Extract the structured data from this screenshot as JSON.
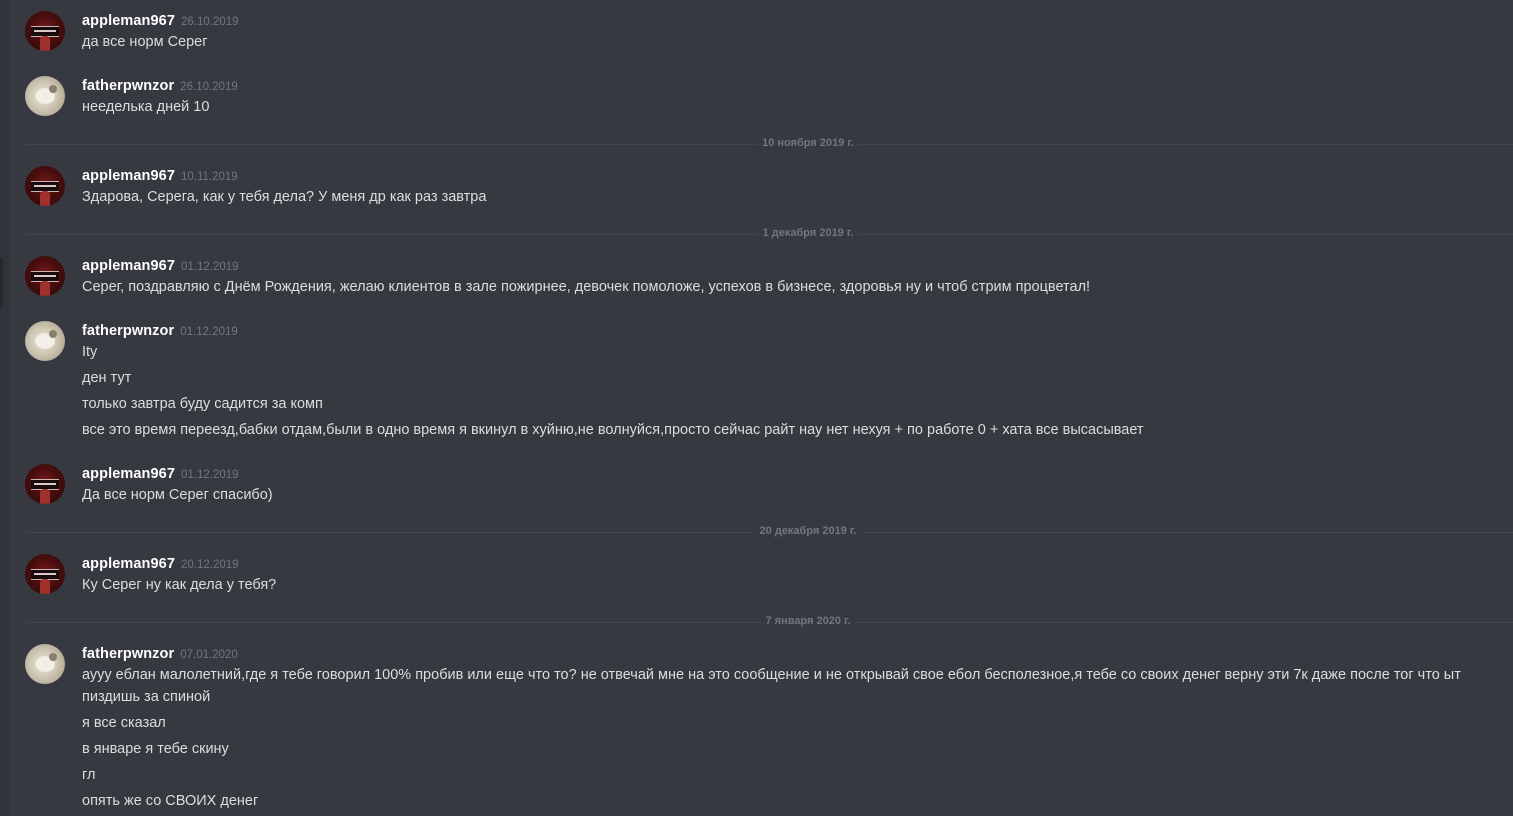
{
  "dividers": [
    {
      "label": "10 ноября 2019 г."
    },
    {
      "label": "1 декабря 2019 г."
    },
    {
      "label": "20 декабря 2019 г."
    },
    {
      "label": "7 января 2020 г."
    }
  ],
  "messages": [
    {
      "author": "appleman967",
      "time": "26.10.2019",
      "avatar": "red-poster-avatar",
      "lines": [
        "да все норм Серег"
      ]
    },
    {
      "author": "fatherpwnzor",
      "time": "26.10.2019",
      "avatar": "white-pet-avatar",
      "lines": [
        "нееделька дней 10"
      ]
    },
    {
      "author": "appleman967",
      "time": "10.11.2019",
      "avatar": "red-poster-avatar",
      "lines": [
        "Здарова, Серега, как у тебя дела? У меня др как раз завтра"
      ]
    },
    {
      "author": "appleman967",
      "time": "01.12.2019",
      "avatar": "red-poster-avatar",
      "lines": [
        "Серег, поздравляю с Днём Рождения, желаю клиентов в зале пожирнее, девочек помоложе, успехов в бизнесе, здоровья ну и чтоб стрим процветал!"
      ]
    },
    {
      "author": "fatherpwnzor",
      "time": "01.12.2019",
      "avatar": "white-pet-avatar",
      "lines": [
        "Ity",
        "ден тут",
        "только завтра буду садится за комп",
        "все это время переезд,бабки отдам,были в одно время я вкинул в хуйню,не волнуйся,просто сейчас райт нау нет нехуя + по работе 0 + хата все высасывает"
      ]
    },
    {
      "author": "appleman967",
      "time": "01.12.2019",
      "avatar": "red-poster-avatar",
      "lines": [
        "Да все норм Серег спасибо)"
      ]
    },
    {
      "author": "appleman967",
      "time": "20.12.2019",
      "avatar": "red-poster-avatar",
      "lines": [
        "Ку Серег ну как дела у тебя?"
      ]
    },
    {
      "author": "fatherpwnzor",
      "time": "07.01.2020",
      "avatar": "white-pet-avatar",
      "lines": [
        "аууу еблан малолетний,где я тебе говорил 100% пробив или еще что то? не отвечай мне на это сообщение и не открывай свое ебол бесполезное,я тебе со своих денег верну эти 7к даже после тог что ыт пиздишь за спиной",
        "я все сказал",
        "в январе я тебе скину",
        "гл",
        "опять же со СВОИХ денег"
      ]
    }
  ]
}
